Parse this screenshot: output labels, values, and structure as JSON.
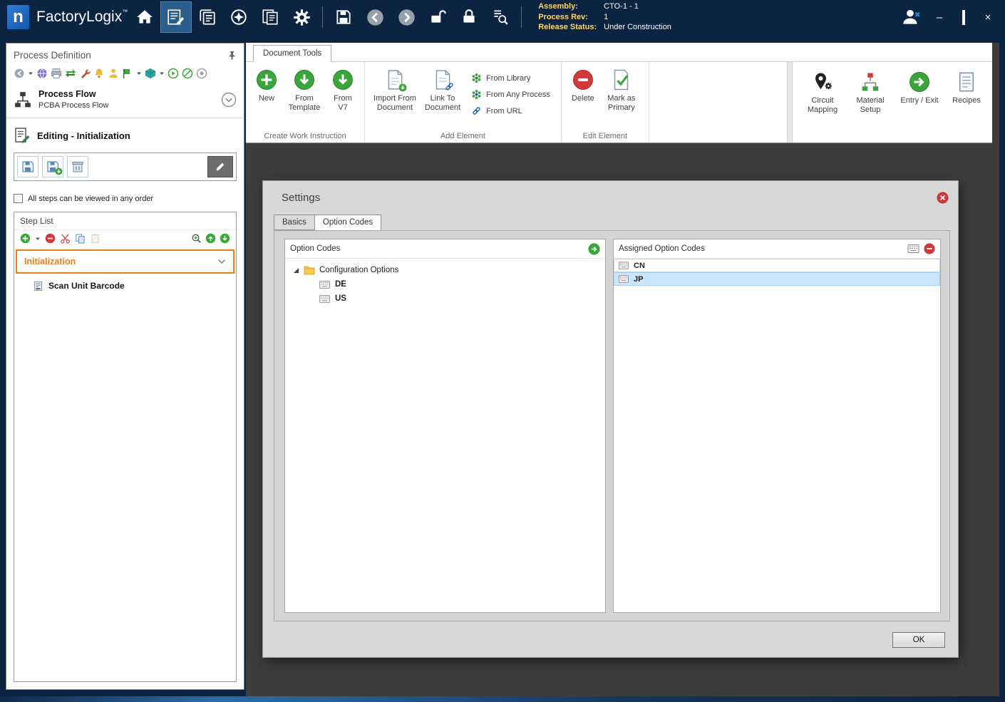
{
  "titlebar": {
    "app_name": "FactoryLogix",
    "trademark": "™",
    "info": {
      "assembly_label": "Assembly:",
      "assembly_value": "CTO-1 - 1",
      "process_rev_label": "Process Rev:",
      "process_rev_value": "1",
      "release_status_label": "Release Status:",
      "release_status_value": "Under Construction"
    },
    "window_controls": {
      "minimize": "–",
      "maximize": "□",
      "close": "×"
    }
  },
  "sidebar": {
    "title": "Process Definition",
    "process_flow": {
      "title": "Process Flow",
      "subtitle": "PCBA Process Flow"
    },
    "editing_title": "Editing - Initialization",
    "order_checkbox_label": "All steps can be viewed in any order",
    "order_checkbox_checked": false,
    "step_list": {
      "title": "Step List",
      "steps": [
        {
          "label": "Initialization",
          "selected": true
        },
        {
          "label": "Scan Unit Barcode",
          "selected": false
        }
      ]
    }
  },
  "ribbon": {
    "tab_label": "Document Tools",
    "groups": [
      {
        "label": "Create Work Instruction",
        "buttons": [
          {
            "label": "New"
          },
          {
            "label": "From Template"
          },
          {
            "label": "From V7"
          }
        ]
      },
      {
        "label": "Add Element",
        "buttons": [
          {
            "label": "Import From Document"
          },
          {
            "label": "Link To Document"
          }
        ],
        "menu_buttons": [
          {
            "label": "From Library"
          },
          {
            "label": "From Any Process"
          },
          {
            "label": "From URL"
          }
        ]
      },
      {
        "label": "Edit Element",
        "buttons": [
          {
            "label": "Delete"
          },
          {
            "label": "Mark as Primary"
          }
        ]
      }
    ],
    "right_buttons": [
      {
        "label": "Circuit Mapping"
      },
      {
        "label": "Material Setup"
      },
      {
        "label": "Entry / Exit"
      },
      {
        "label": "Recipes"
      }
    ]
  },
  "dialog": {
    "title": "Settings",
    "tabs": [
      {
        "label": "Basics",
        "active": false
      },
      {
        "label": "Option Codes",
        "active": true
      }
    ],
    "option_codes": {
      "title": "Option Codes",
      "root": "Configuration Options",
      "children": [
        {
          "label": "DE"
        },
        {
          "label": "US"
        }
      ]
    },
    "assigned": {
      "title": "Assigned Option Codes",
      "items": [
        {
          "label": "CN",
          "selected": false
        },
        {
          "label": "JP",
          "selected": true
        }
      ]
    },
    "ok_label": "OK"
  },
  "colors": {
    "titlebar_bg": "#0c2341",
    "content_bg": "#3d3d3d",
    "dialog_bg": "#d8d8d8",
    "selection_blue": "#cbe6f8",
    "step_highlight_orange": "#e87f1f",
    "icon_green": "#3aa53a",
    "icon_red": "#d03a3a",
    "label_yellow": "#ffd964"
  },
  "icons": {
    "home-icon": "house",
    "work-instruction-icon": "document+pencil",
    "templates-icon": "stacked-docs",
    "dispatch-icon": "compass",
    "reports-icon": "double-doc",
    "gear-icon": "gear",
    "save-icon": "floppy",
    "back-icon": "circle-left-arrow",
    "forward-icon": "circle-right-arrow",
    "unlock-icon": "open-padlock",
    "lock-icon": "closed-padlock",
    "audit-icon": "list+magnifier",
    "user-logoff-icon": "person+x",
    "minimize-icon": "–",
    "maximize-icon": "□",
    "close-icon": "×",
    "pin-icon": "pushpin",
    "add-icon": "green-circle-plus",
    "remove-icon": "red-circle-minus",
    "cut-icon": "scissors",
    "copy-icon": "two-pages",
    "paste-icon": "clipboard",
    "zoom-icon": "magnifier-plus",
    "move-up-icon": "green-circle-up",
    "move-down-icon": "green-circle-down",
    "folder-icon": "yellow-folder",
    "option-code-icon": "keyboard-chip",
    "assign-icon": "green-circle-right",
    "delete-icon": "red-circle-minus",
    "primary-check-icon": "doc+green-check",
    "link-icon": "chain",
    "circuit-mapping-icon": "map-pin+gear",
    "material-setup-icon": "node-diagram",
    "entry-exit-icon": "green-circle-arrow",
    "recipes-icon": "lined-card"
  }
}
